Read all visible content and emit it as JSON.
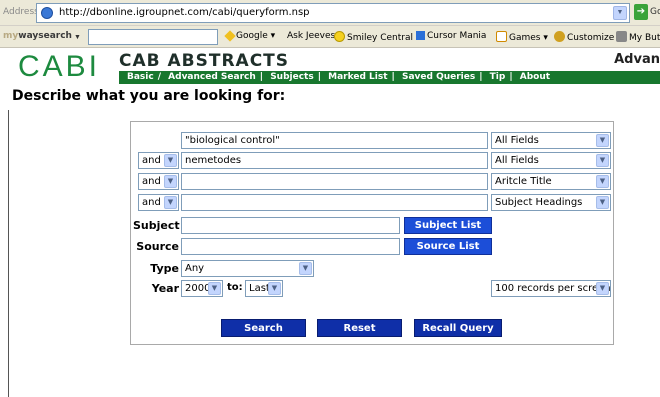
{
  "browser": {
    "address_label": "Address",
    "url": "http://dbonline.igroupnet.com/cabi/queryform.nsp",
    "go_label": "Go"
  },
  "toolbar": {
    "brand_prefix": "my",
    "brand_name": "waysearch",
    "items": [
      {
        "label": "Google",
        "icon": "google-icon"
      },
      {
        "label": "Ask Jeeves",
        "icon": "ask-jeeves-icon"
      },
      {
        "label": "Smiley Central",
        "icon": "smiley-icon"
      },
      {
        "label": "Cursor Mania",
        "icon": "cursor-icon"
      },
      {
        "label": "Games",
        "icon": "games-icon"
      },
      {
        "label": "Customize",
        "icon": "customize-icon"
      },
      {
        "label": "My Button",
        "icon": "button-icon"
      }
    ]
  },
  "header": {
    "logo": "CABI",
    "title": "CAB ABSTRACTS",
    "right_text": "Advan",
    "nav": [
      "Basic",
      "Advanced Search",
      "Subjects",
      "Marked List",
      "Saved Queries",
      "Tip",
      "About"
    ]
  },
  "page": {
    "heading": "Describe what you are looking for:"
  },
  "form": {
    "rows": [
      {
        "operator": "",
        "term": "\"biological control\"",
        "field": "All Fields"
      },
      {
        "operator": "and",
        "term": "nemetodes",
        "field": "All Fields"
      },
      {
        "operator": "and",
        "term": "",
        "field": "Aritcle Title"
      },
      {
        "operator": "and",
        "term": "",
        "field": "Subject Headings"
      }
    ],
    "subject_label": "Subject",
    "subject_value": "",
    "subject_button": "Subject List",
    "source_label": "Source",
    "source_value": "",
    "source_button": "Source List",
    "type_label": "Type",
    "type_value": "Any",
    "year_label": "Year",
    "year_from": "2000",
    "year_to_label": "to:",
    "year_to": "Last",
    "records_per_screen": "100 records per screen",
    "buttons": {
      "search": "Search",
      "reset": "Reset",
      "recall": "Recall Query"
    }
  },
  "colors": {
    "brand_green": "#1d8a3f",
    "nav_green": "#18772e",
    "button_blue": "#1c4ed8",
    "action_blue": "#0f2fa8"
  }
}
